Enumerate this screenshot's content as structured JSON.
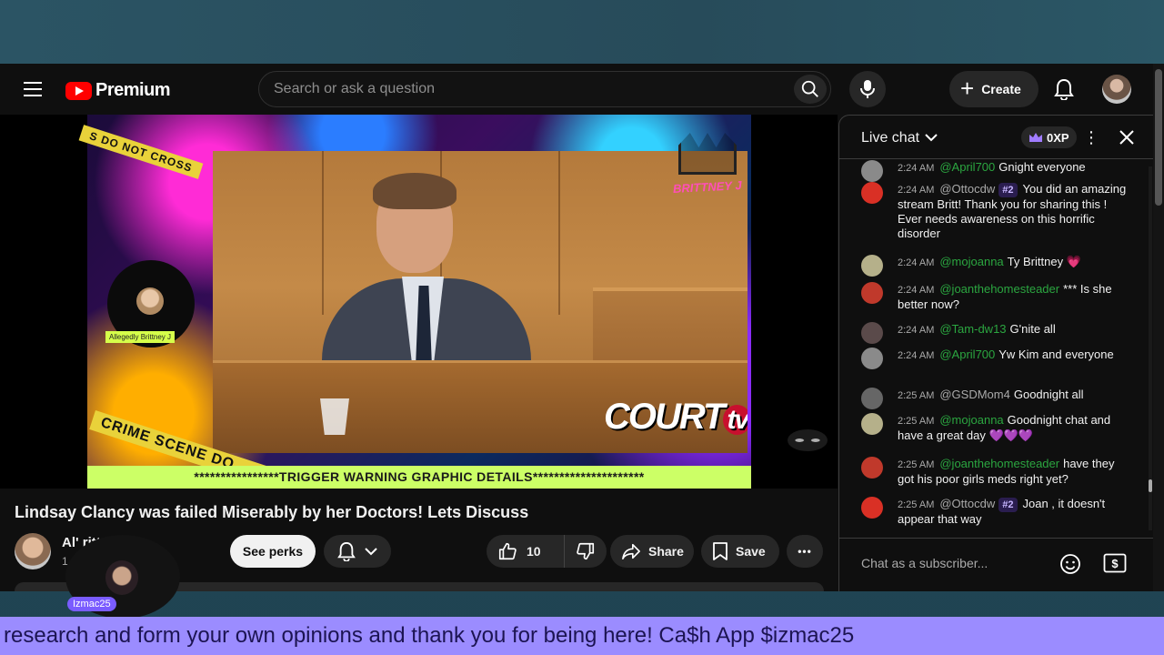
{
  "masthead": {
    "logo_text": "Premium",
    "search_placeholder": "Search or ask a question",
    "create_label": "Create"
  },
  "video": {
    "overlay_brand": "BRITTNEY J",
    "tape_top": "S DO NOT CROSS",
    "tape_bottom": "CRIME SCENE DO",
    "network_logo": "COURT",
    "network_logo_tv": "tv",
    "host_label": "Allegedly Brittney J",
    "warning_text": "****************TRIGGER WARNING GRAPHIC DETAILS*********************"
  },
  "details": {
    "title": "Lindsay Clancy was failed Miserably by her Doctors! Lets Discuss",
    "channel_name": "Al'             rittney J",
    "channel_subs": "1",
    "perks_label": "See perks",
    "like_count": "10",
    "share_label": "Share",
    "save_label": "Save",
    "more_glyph": "•••"
  },
  "chat": {
    "title": "Live chat",
    "xp_label": "0XP",
    "input_placeholder": "Chat as a subscriber...",
    "messages": [
      {
        "time": "2:24 AM",
        "author": "@April700",
        "member": true,
        "rank": "",
        "text": "Gnight everyone",
        "avatar_color": "#8a8a8a"
      },
      {
        "time": "2:24 AM",
        "author": "@Ottocdw",
        "member": false,
        "rank": "#2",
        "text": "You did an amazing stream Britt! Thank you for sharing this ! Ever needs awareness on this horrific disorder",
        "avatar_color": "#d93025"
      },
      {
        "time": "2:24 AM",
        "author": "@mojoanna",
        "member": true,
        "rank": "",
        "text": "Ty Brittney 💗",
        "avatar_color": "#b5b08a"
      },
      {
        "time": "2:24 AM",
        "author": "@joanthehomesteader",
        "member": true,
        "rank": "",
        "text": "*** Is she better now?",
        "avatar_color": "#c0392b"
      },
      {
        "time": "2:24 AM",
        "author": "@Tam-dw13",
        "member": true,
        "rank": "",
        "text": "G'nite all",
        "avatar_color": "#5a4a4a"
      },
      {
        "time": "2:24 AM",
        "author": "@April700",
        "member": true,
        "rank": "",
        "text": "Yw Kim and everyone",
        "avatar_color": "#8a8a8a"
      },
      {
        "time": "2:25 AM",
        "author": "@GSDMom4",
        "member": false,
        "rank": "",
        "text": "Goodnight all",
        "avatar_color": "#666666"
      },
      {
        "time": "2:25 AM",
        "author": "@mojoanna",
        "member": true,
        "rank": "",
        "text": "Goodnight chat and have a great day 💜💜💜",
        "avatar_color": "#b5b08a"
      },
      {
        "time": "2:25 AM",
        "author": "@joanthehomesteader",
        "member": true,
        "rank": "",
        "text": "have they got his poor girls meds right yet?",
        "avatar_color": "#c0392b"
      },
      {
        "time": "2:25 AM",
        "author": "@Ottocdw",
        "member": false,
        "rank": "#2",
        "text": "Joan , it doesn't appear that way",
        "avatar_color": "#d93025"
      }
    ]
  },
  "stream": {
    "streamer_tag": "Izmac25",
    "ticker_text": "research and form your own opinions and thank you for being here! Ca$h App $izmac25"
  }
}
